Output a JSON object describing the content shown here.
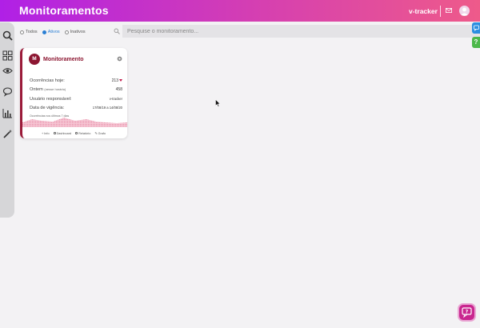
{
  "header": {
    "title": "Monitoramentos",
    "brand": "v-tracker"
  },
  "sidebar": {
    "items": [
      {
        "icon": "search-icon"
      },
      {
        "icon": "grid-icon"
      },
      {
        "icon": "eye-icon"
      },
      {
        "icon": "chat-icon"
      },
      {
        "icon": "bar-chart-icon"
      },
      {
        "icon": "magic-wand-icon"
      }
    ]
  },
  "filters": {
    "options": [
      {
        "label": "Todos",
        "selected": false
      },
      {
        "label": "Ativos",
        "selected": true
      },
      {
        "label": "Inativos",
        "selected": false
      }
    ]
  },
  "search": {
    "placeholder": "Pesquise o monitoramento..."
  },
  "card": {
    "avatar_letter": "M",
    "title": "Monitoramento",
    "rows": [
      {
        "label": "Ocorrências hoje:",
        "value": "213",
        "trend": "down"
      },
      {
        "label": "Ontem",
        "note": "(nesse horário)",
        "value": "458"
      },
      {
        "label": "Usuário responsável:",
        "value": "v-tracker"
      },
      {
        "label": "Data de vigência:",
        "value": "17/08/19 a 14/08/20"
      }
    ],
    "spark_label": "Ocorrências nos últimos 7 dias",
    "footer": [
      {
        "label": "Info",
        "icon": "plus-icon"
      },
      {
        "label": "Dashboard",
        "icon": "monitor-icon"
      },
      {
        "label": "Relatório",
        "icon": "report-icon"
      },
      {
        "label": "Grafo",
        "icon": "graph-icon"
      }
    ]
  },
  "green_tab": {
    "label": "?"
  },
  "colors": {
    "header_start": "#b020e6",
    "header_end": "#ee5a8a",
    "accent_dark_red": "#8c1631",
    "selected_blue": "#2a7fd4"
  }
}
